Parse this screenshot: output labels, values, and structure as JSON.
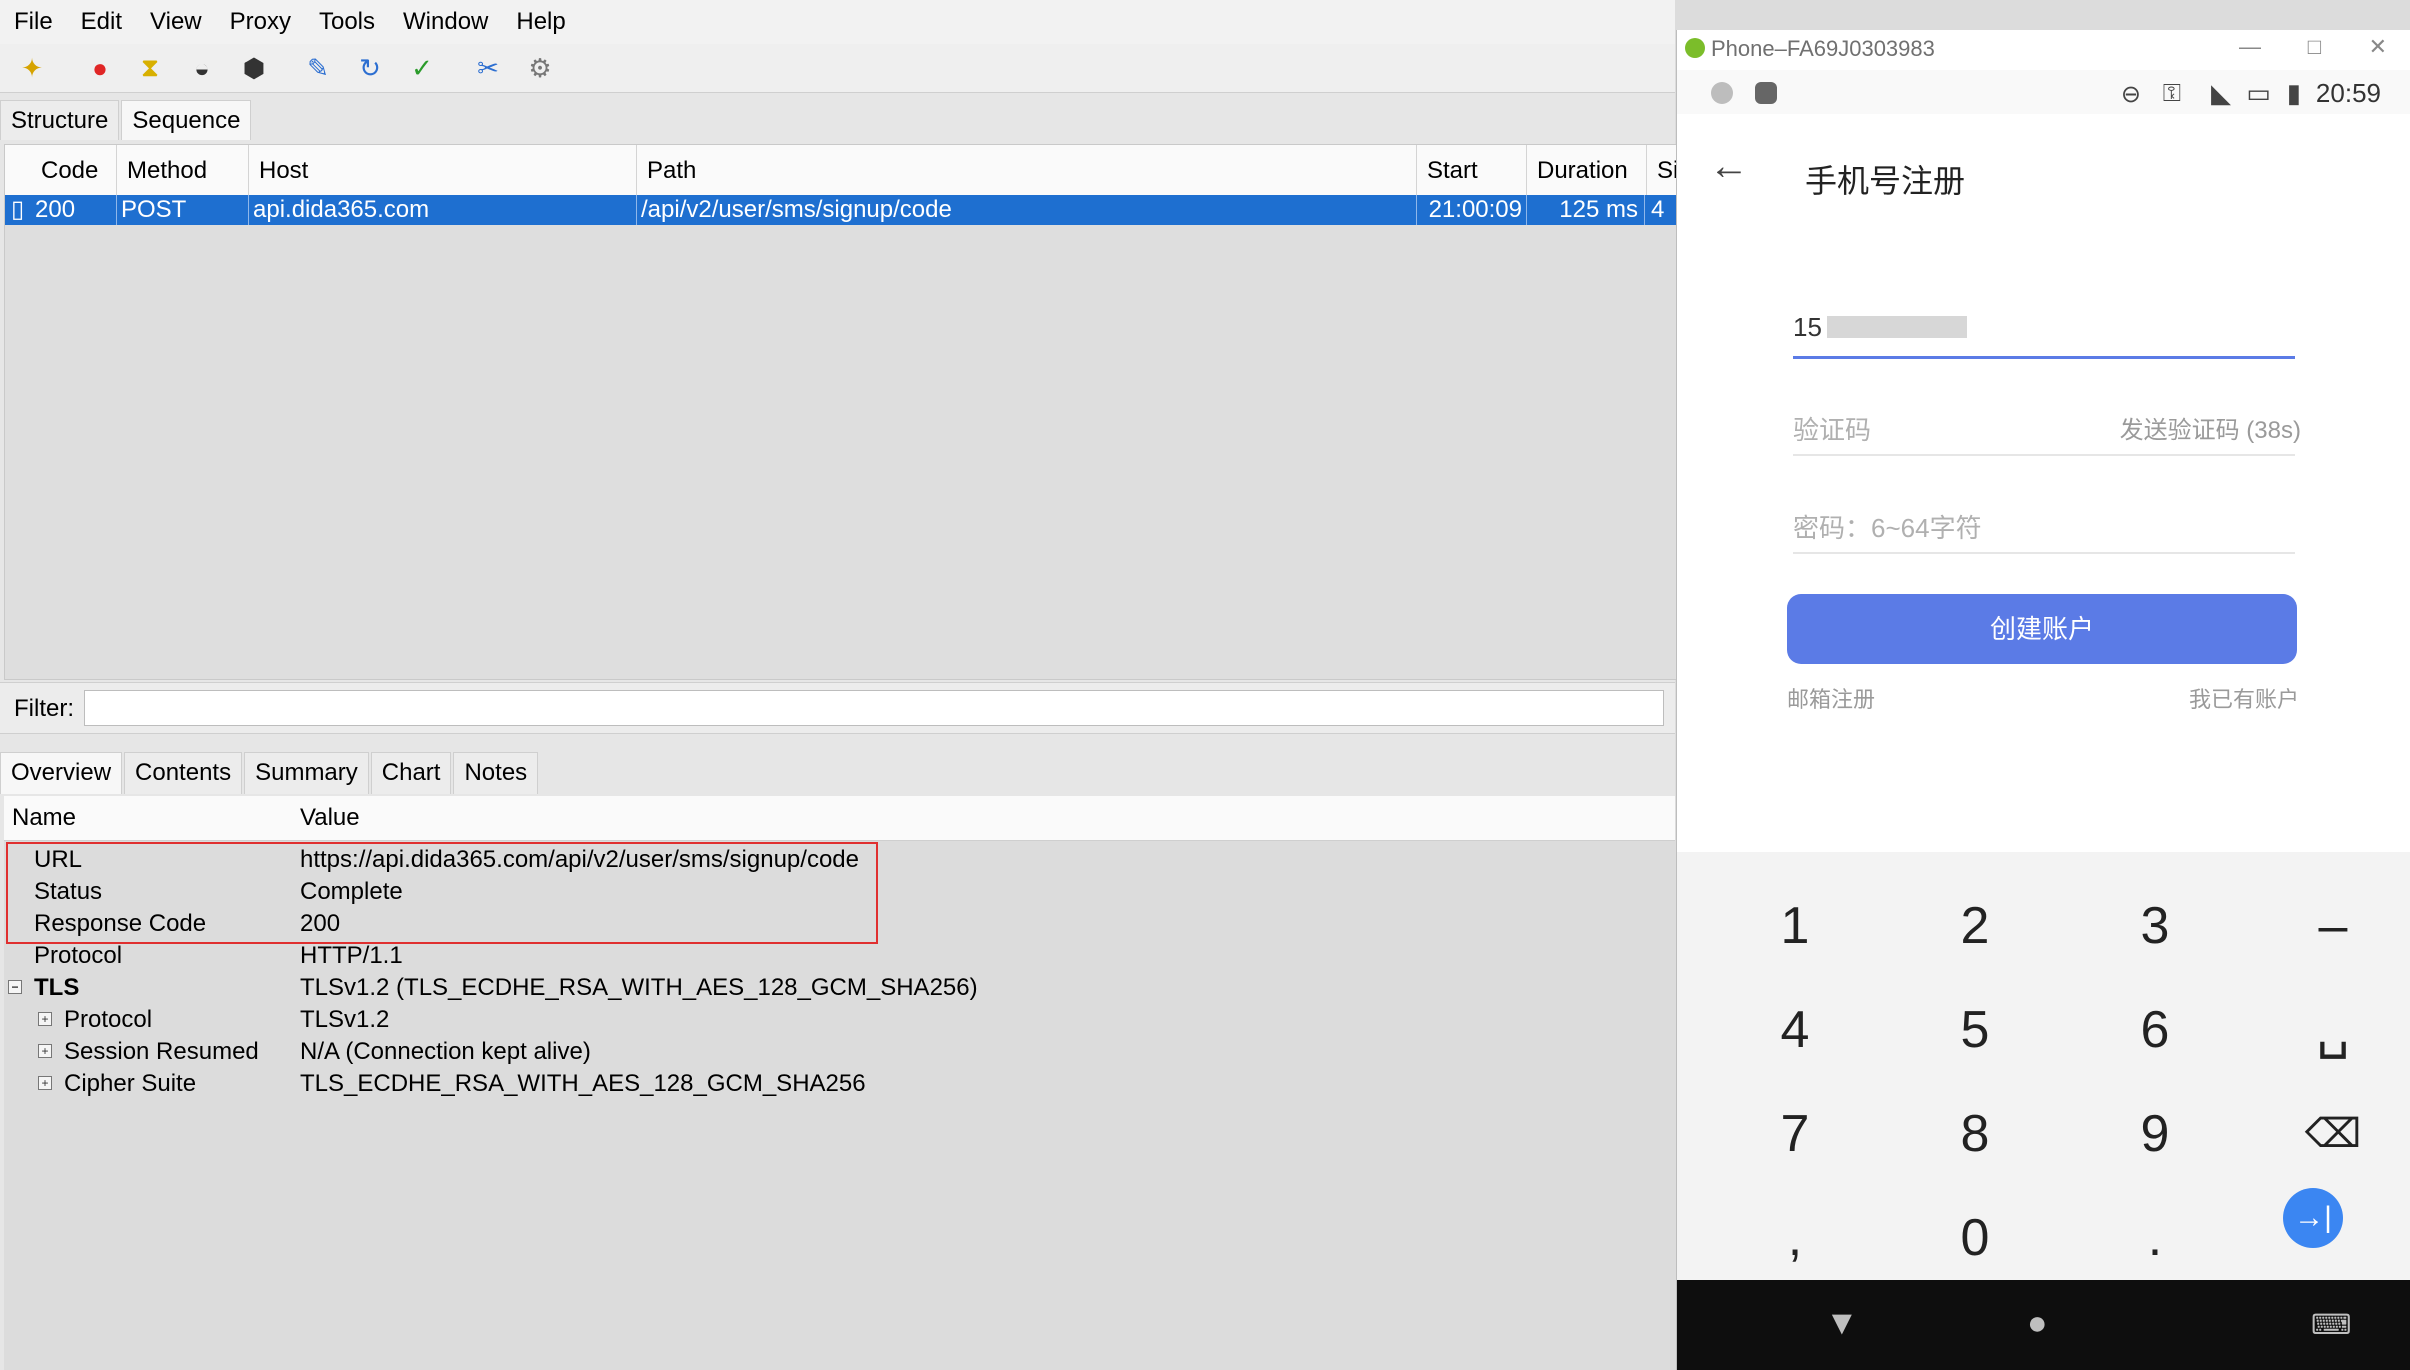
{
  "menu": [
    "File",
    "Edit",
    "View",
    "Proxy",
    "Tools",
    "Window",
    "Help"
  ],
  "tabs_top": [
    "Structure",
    "Sequence"
  ],
  "table": {
    "columns": [
      "Code",
      "Method",
      "Host",
      "Path",
      "Start",
      "Duration",
      "Siz"
    ],
    "row": [
      "200",
      "POST",
      "api.dida365.com",
      "/api/v2/user/sms/signup/code",
      "21:00:09",
      "125 ms",
      "4"
    ]
  },
  "filter": {
    "label": "Filter:"
  },
  "tabs_bottom": [
    "Overview",
    "Contents",
    "Summary",
    "Chart",
    "Notes"
  ],
  "details": {
    "headers": [
      "Name",
      "Value"
    ],
    "rows": [
      {
        "name": "URL",
        "value": "https://api.dida365.com/api/v2/user/sms/signup/code"
      },
      {
        "name": "Status",
        "value": "Complete"
      },
      {
        "name": "Response Code",
        "value": "200"
      },
      {
        "name": "Protocol",
        "value": "HTTP/1.1"
      },
      {
        "name": "TLS",
        "value": "TLSv1.2 (TLS_ECDHE_RSA_WITH_AES_128_GCM_SHA256)"
      },
      {
        "name": "Protocol",
        "value": "TLSv1.2"
      },
      {
        "name": "Session Resumed",
        "value": "N/A (Connection kept alive)"
      },
      {
        "name": "Cipher Suite",
        "value": "TLS_ECDHE_RSA_WITH_AES_128_GCM_SHA256"
      }
    ]
  },
  "phone": {
    "window_title": "Phone–FA69J0303983",
    "time": "20:59",
    "appbar_title": "手机号注册",
    "phone_number": "15",
    "code_placeholder": "验证码",
    "send_code": "发送验证码 (38s)",
    "password_placeholder": "密码：6~64字符",
    "primary_button": "创建账户",
    "email_register": "邮箱注册",
    "have_account": "我已有账户",
    "keys": [
      "1",
      "2",
      "3",
      "–",
      "4",
      "5",
      "6",
      "␣",
      "7",
      "8",
      "9",
      "⌫",
      ",",
      "0",
      ".",
      "→|"
    ]
  }
}
